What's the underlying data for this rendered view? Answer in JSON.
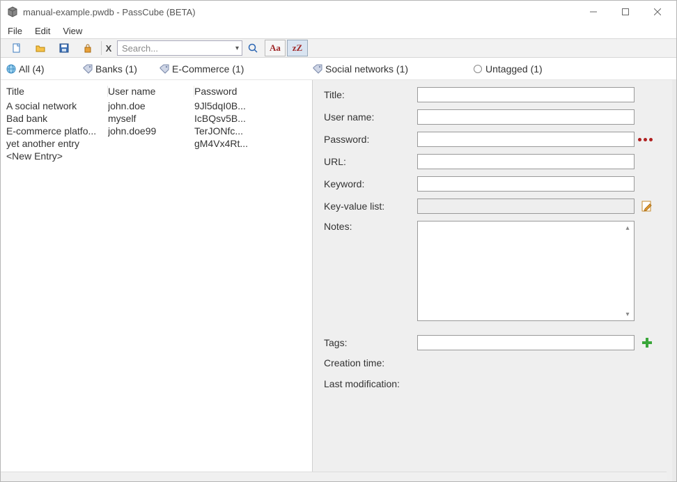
{
  "window": {
    "title": "manual-example.pwdb - PassCube (BETA)"
  },
  "menu": {
    "file": "File",
    "edit": "Edit",
    "view": "View"
  },
  "toolbar": {
    "clear_x": "X",
    "search_placeholder": "Search...",
    "aa": "Aa",
    "zz": "zZ"
  },
  "tags": {
    "all": "All (4)",
    "banks": "Banks (1)",
    "ecom": "E-Commerce (1)",
    "social": "Social networks (1)",
    "untag": "Untagged (1)"
  },
  "table": {
    "hdr_title": "Title",
    "hdr_user": "User name",
    "hdr_pass": "Password",
    "rows": [
      {
        "title": "A social network",
        "user": "john.doe",
        "pass": "9Jl5dqI0B..."
      },
      {
        "title": "Bad bank",
        "user": "myself",
        "pass": "IcBQsv5B..."
      },
      {
        "title": "E-commerce platfo...",
        "user": "john.doe99",
        "pass": "TerJONfc..."
      },
      {
        "title": "yet another entry",
        "user": "",
        "pass": "gM4Vx4Rt..."
      },
      {
        "title": "<New Entry>",
        "user": "",
        "pass": ""
      }
    ]
  },
  "form": {
    "lbl_title": "Title:",
    "lbl_user": "User name:",
    "lbl_pass": "Password:",
    "lbl_url": "URL:",
    "lbl_keyword": "Keyword:",
    "lbl_kvlist": "Key-value list:",
    "lbl_notes": "Notes:",
    "lbl_tags": "Tags:",
    "lbl_ctime": "Creation time:",
    "lbl_mtime": "Last modification:"
  }
}
